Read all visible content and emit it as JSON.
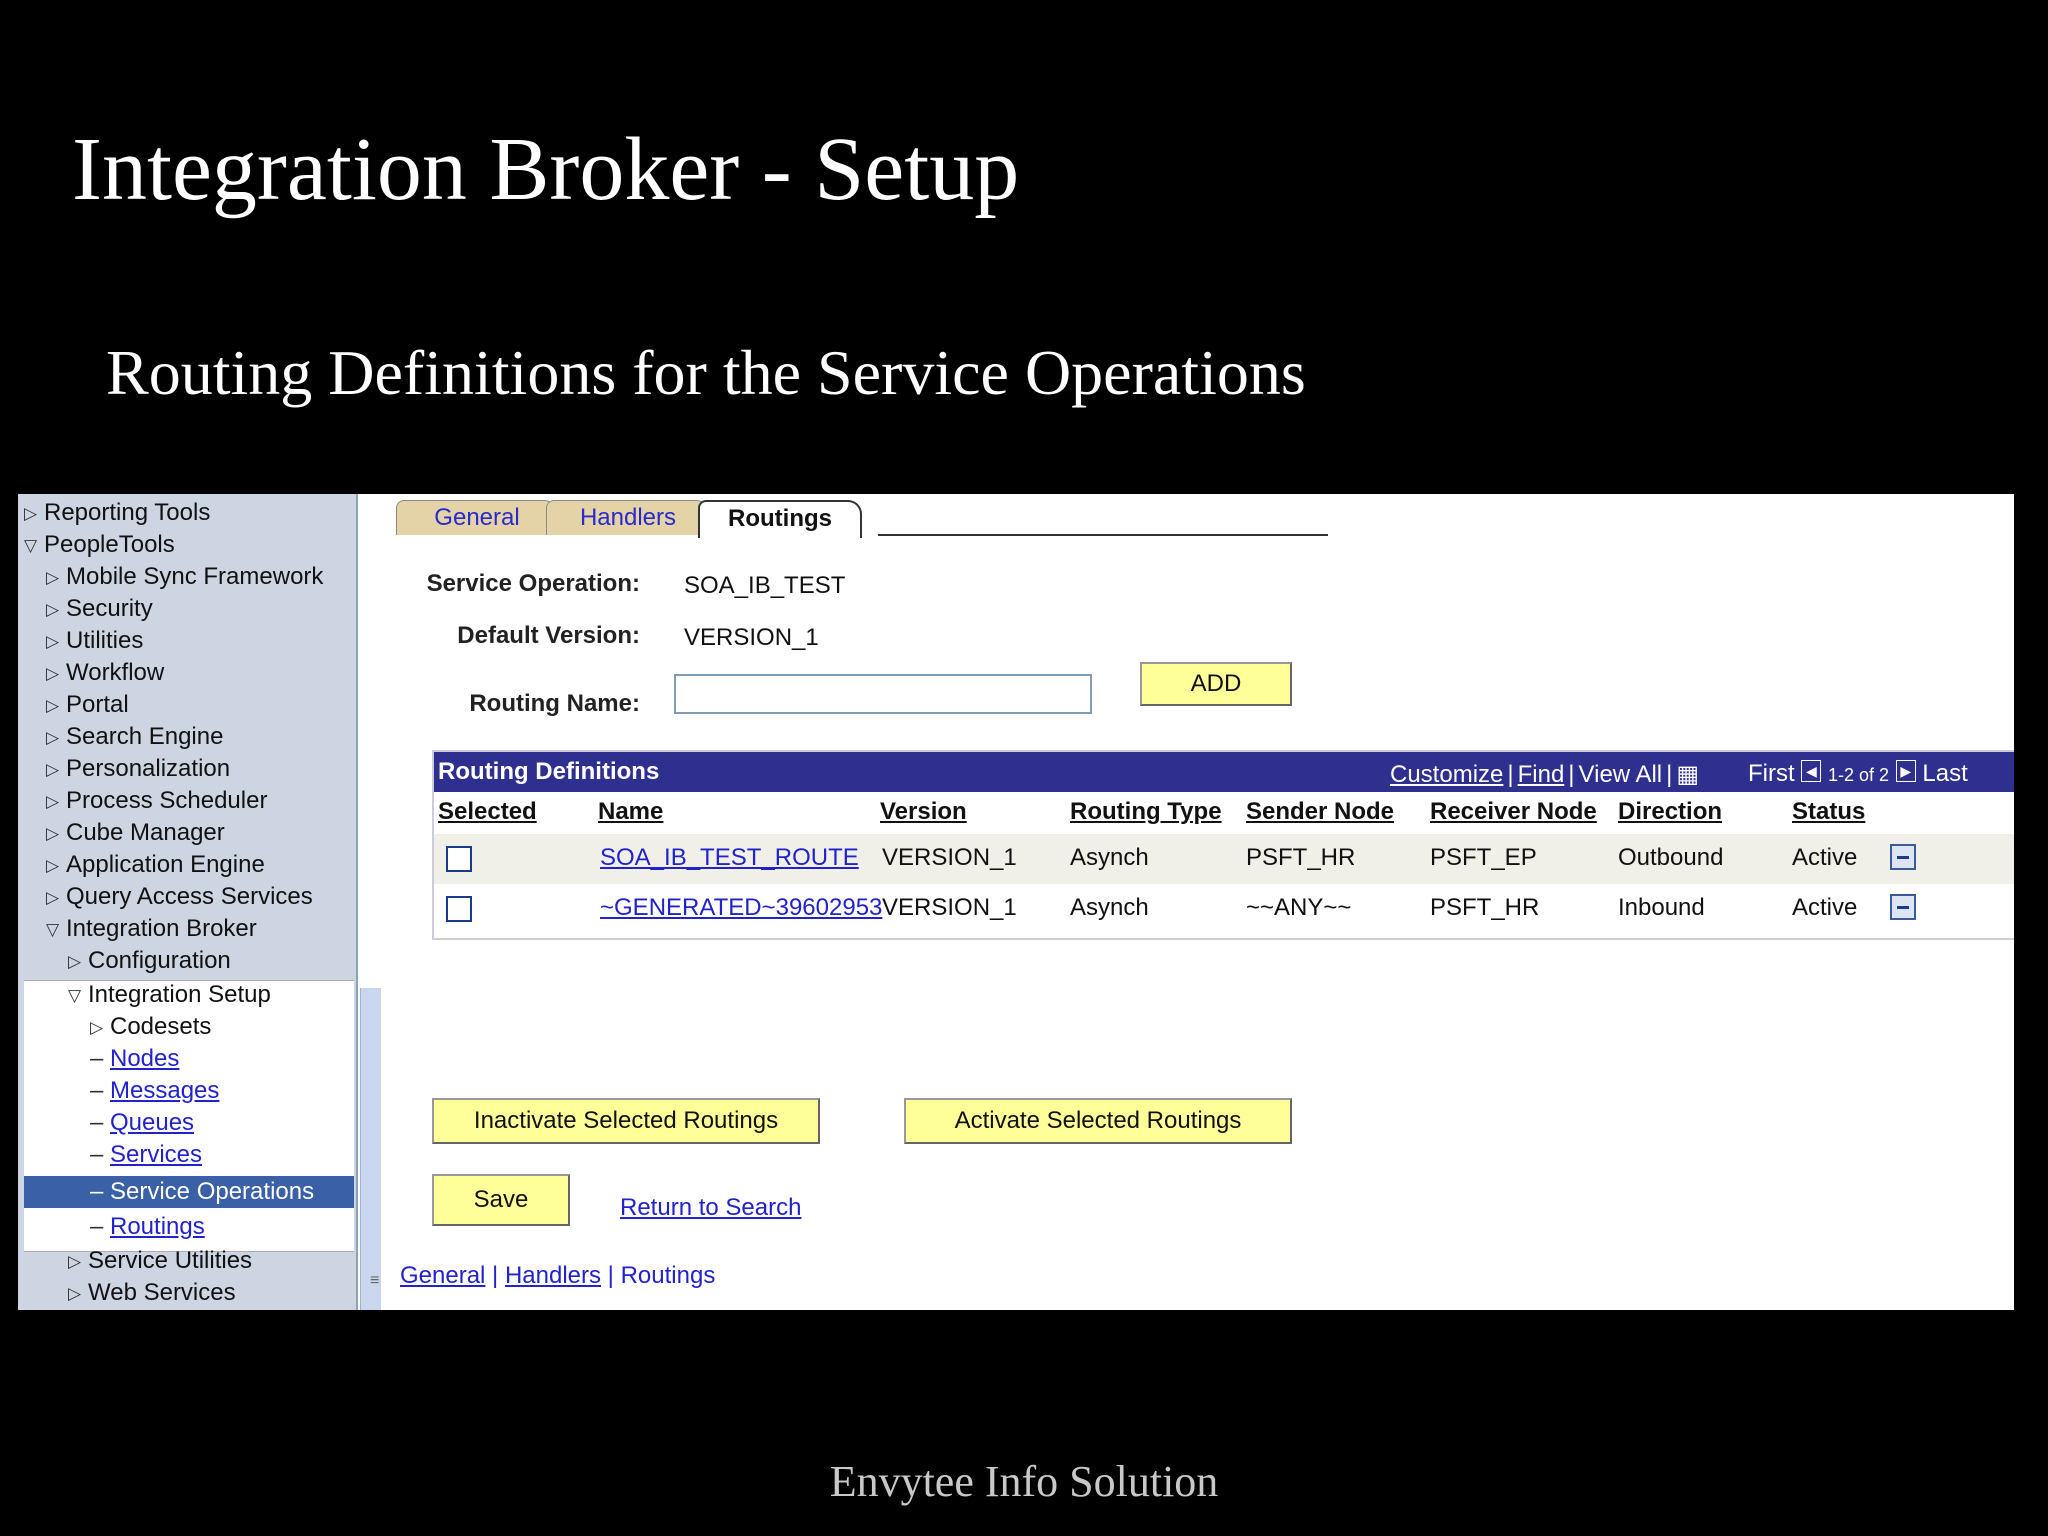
{
  "slide": {
    "title": "Integration Broker - Setup",
    "subtitle": "Routing Definitions for the Service Operations",
    "footer": "Envytee Info Solution"
  },
  "nav": {
    "items": [
      {
        "label": "Reporting Tools",
        "type": "collapsed"
      },
      {
        "label": "PeopleTools",
        "type": "expanded"
      },
      {
        "label": "Mobile Sync Framework",
        "type": "collapsed"
      },
      {
        "label": "Security",
        "type": "collapsed"
      },
      {
        "label": "Utilities",
        "type": "collapsed"
      },
      {
        "label": "Workflow",
        "type": "collapsed"
      },
      {
        "label": "Portal",
        "type": "collapsed"
      },
      {
        "label": "Search Engine",
        "type": "collapsed"
      },
      {
        "label": "Personalization",
        "type": "collapsed"
      },
      {
        "label": "Process Scheduler",
        "type": "collapsed"
      },
      {
        "label": "Cube Manager",
        "type": "collapsed"
      },
      {
        "label": "Application Engine",
        "type": "collapsed"
      },
      {
        "label": "Query Access Services",
        "type": "collapsed"
      },
      {
        "label": "Integration Broker",
        "type": "expanded"
      },
      {
        "label": "Configuration",
        "type": "collapsed"
      },
      {
        "label": "Integration Setup",
        "type": "expanded"
      },
      {
        "label": "Codesets",
        "type": "collapsed"
      },
      {
        "label": "Nodes",
        "type": "link"
      },
      {
        "label": "Messages",
        "type": "link"
      },
      {
        "label": "Queues",
        "type": "link"
      },
      {
        "label": "Services",
        "type": "link"
      },
      {
        "label": "Service Operations",
        "type": "selected"
      },
      {
        "label": "Routings",
        "type": "link"
      },
      {
        "label": "Service Utilities",
        "type": "collapsed"
      },
      {
        "label": "Web Services",
        "type": "collapsed"
      }
    ]
  },
  "tabs": {
    "general": "General",
    "handlers": "Handlers",
    "routings": "Routings"
  },
  "form": {
    "service_operation_label": "Service Operation:",
    "service_operation_value": "SOA_IB_TEST",
    "default_version_label": "Default Version:",
    "default_version_value": "VERSION_1",
    "routing_name_label": "Routing Name:",
    "routing_name_value": "",
    "add_label": "ADD"
  },
  "grid": {
    "title": "Routing Definitions",
    "customize": "Customize",
    "find": "Find",
    "view_all": "View All",
    "first": "First",
    "range": "1-2 of 2",
    "last": "Last",
    "columns": [
      "Selected",
      "Name",
      "Version",
      "Routing Type",
      "Sender Node",
      "Receiver Node",
      "Direction",
      "Status"
    ],
    "rows": [
      {
        "name": "SOA_IB_TEST_ROUTE",
        "version": "VERSION_1",
        "routing_type": "Asynch",
        "sender": "PSFT_HR",
        "receiver": "PSFT_EP",
        "direction": "Outbound",
        "status": "Active"
      },
      {
        "name": "~GENERATED~39602953",
        "version": "VERSION_1",
        "routing_type": "Asynch",
        "sender": "~~ANY~~",
        "receiver": "PSFT_HR",
        "direction": "Inbound",
        "status": "Active"
      }
    ]
  },
  "actions": {
    "inactivate": "Inactivate Selected Routings",
    "activate": "Activate Selected Routings",
    "save": "Save",
    "return_to_search": "Return to Search"
  },
  "bottom_links": {
    "general": "General",
    "handlers": "Handlers",
    "routings": "Routings"
  }
}
